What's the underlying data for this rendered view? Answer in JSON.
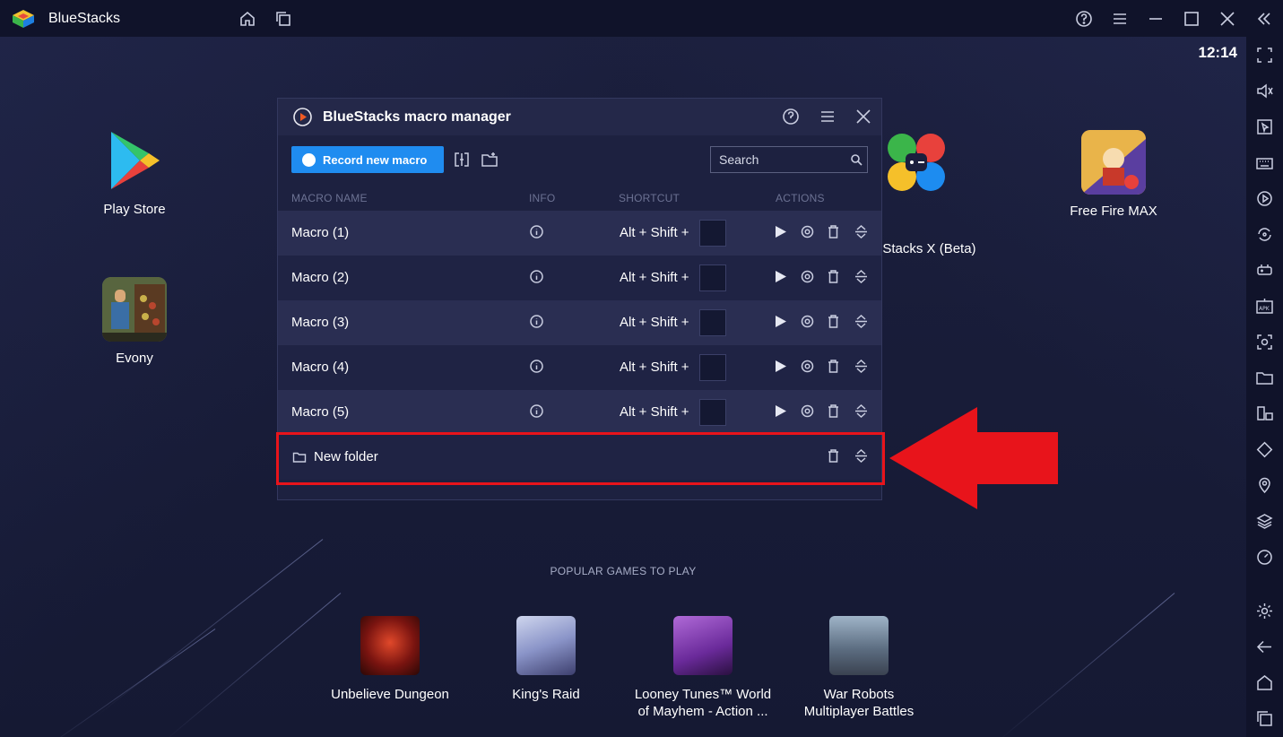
{
  "titlebar": {
    "app_name": "BlueStacks",
    "icons": [
      "home-icon",
      "multi-instance-icon",
      "help-icon",
      "menu-icon",
      "minimize-icon",
      "maximize-icon",
      "close-icon",
      "collapse-sidebar-icon"
    ]
  },
  "clock": "12:14",
  "desktop_apps": [
    {
      "label": "Play Store",
      "icon": "play-store-icon"
    },
    {
      "label": "Evony",
      "icon": "evony-icon"
    },
    {
      "label": "eStacks X (Beta)",
      "icon": "bluestacks-x-icon"
    },
    {
      "label": "Free Fire MAX",
      "icon": "free-fire-max-icon"
    }
  ],
  "popular": {
    "title": "POPULAR GAMES TO PLAY",
    "games": [
      {
        "line1": "Unbelieve Dungeon",
        "line2": ""
      },
      {
        "line1": "King's Raid",
        "line2": ""
      },
      {
        "line1": "Looney Tunes™ World",
        "line2": "of Mayhem - Action ..."
      },
      {
        "line1": "War Robots",
        "line2": "Multiplayer Battles"
      }
    ]
  },
  "macro_manager": {
    "title": "BlueStacks macro manager",
    "record_label": "Record new macro",
    "search_placeholder": "Search",
    "columns": {
      "name": "MACRO NAME",
      "info": "INFO",
      "shortcut": "SHORTCUT",
      "actions": "ACTIONS"
    },
    "macros": [
      {
        "name": "Macro (1)",
        "shortcut": "Alt + Shift +",
        "key": ""
      },
      {
        "name": "Macro (2)",
        "shortcut": "Alt + Shift +",
        "key": ""
      },
      {
        "name": "Macro (3)",
        "shortcut": "Alt + Shift +",
        "key": ""
      },
      {
        "name": "Macro (4)",
        "shortcut": "Alt + Shift +",
        "key": ""
      },
      {
        "name": "Macro (5)",
        "shortcut": "Alt + Shift +",
        "key": ""
      }
    ],
    "folder": {
      "name": "New folder"
    }
  },
  "colors": {
    "accent": "#1f8cf0",
    "highlight": "#e8141b",
    "background": "#161a33"
  },
  "sidebar_icons": [
    "fullscreen-icon",
    "volume-icon",
    "pointer-icon",
    "keyboard-icon",
    "macro-record-icon",
    "sync-icon",
    "gamepad-icon",
    "apk-icon",
    "screenshot-icon",
    "folder-icon",
    "multi-instance-icon",
    "rotate-icon",
    "location-icon",
    "layers-icon",
    "performance-icon",
    "settings-icon",
    "back-icon",
    "home-icon",
    "recents-icon"
  ]
}
